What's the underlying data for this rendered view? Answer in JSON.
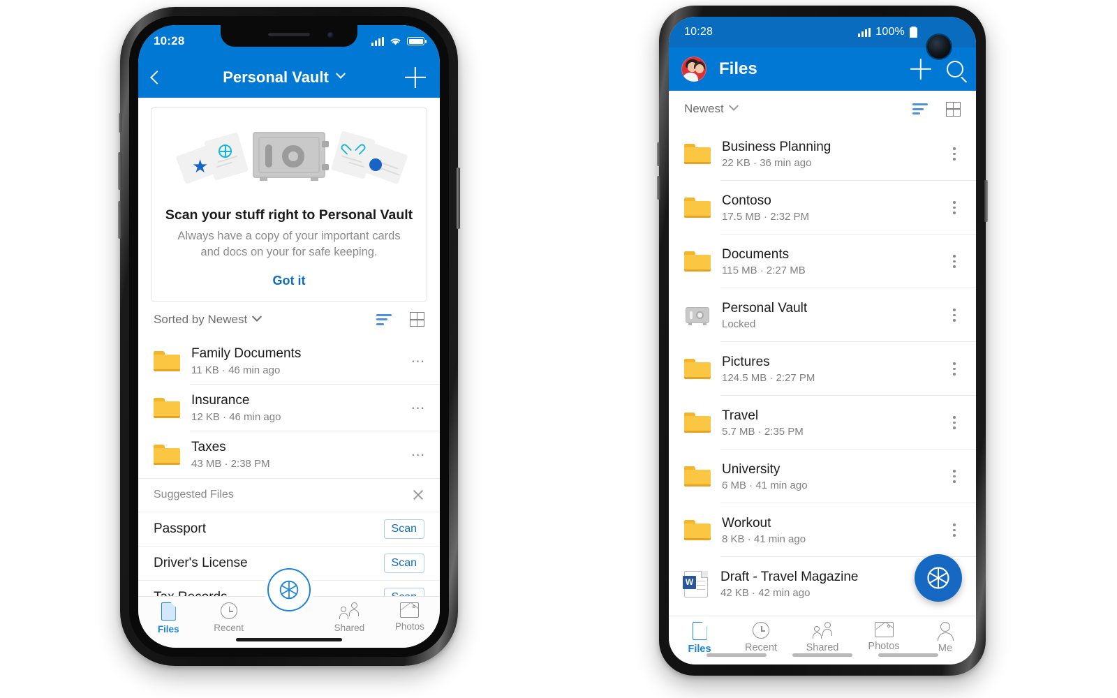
{
  "iphone": {
    "status": {
      "time": "10:28",
      "signal_icon": "cellular-signal-icon",
      "wifi_icon": "wifi-icon",
      "battery_icon": "battery-icon"
    },
    "appbar": {
      "back_icon": "back-chevron-icon",
      "title": "Personal Vault",
      "title_chevron_icon": "chevron-down-icon",
      "add_icon": "plus-icon"
    },
    "promo_card": {
      "illustration_icons": [
        "globe-icon",
        "heart-icon",
        "star-icon",
        "dot-icon",
        "safe-icon"
      ],
      "title": "Scan your stuff right to Personal Vault",
      "body": "Always have a copy of your important cards and docs on your for safe keeping.",
      "cta": "Got it"
    },
    "sort": {
      "label": "Sorted by Newest",
      "chevron_icon": "chevron-down-icon",
      "list_icon": "sort-list-icon",
      "grid_icon": "grid-view-icon"
    },
    "files": [
      {
        "icon": "folder-icon",
        "name": "Family Documents",
        "meta": "11 KB · 46 min ago",
        "menu_icon": "more-horizontal-icon"
      },
      {
        "icon": "folder-icon",
        "name": "Insurance",
        "meta": "12 KB · 46 min ago",
        "menu_icon": "more-horizontal-icon"
      },
      {
        "icon": "folder-icon",
        "name": "Taxes",
        "meta": "43 MB · 2:38 PM",
        "menu_icon": "more-horizontal-icon"
      }
    ],
    "suggested": {
      "header": "Suggested Files",
      "close_icon": "close-icon",
      "items": [
        {
          "name": "Passport",
          "action": "Scan"
        },
        {
          "name": "Driver's License",
          "action": "Scan"
        },
        {
          "name": "Tax Records",
          "action": "Scan"
        }
      ]
    },
    "scan_button_icon": "camera-aperture-icon",
    "tabs": [
      {
        "label": "Files",
        "icon": "document-icon",
        "active": true
      },
      {
        "label": "Recent",
        "icon": "clock-icon",
        "active": false
      },
      {
        "label": "Shared",
        "icon": "people-icon",
        "active": false
      },
      {
        "label": "Photos",
        "icon": "photo-icon",
        "active": false
      }
    ]
  },
  "android": {
    "status": {
      "time": "10:28",
      "signal_icon": "cellular-signal-icon",
      "battery_text": "100%",
      "battery_icon": "battery-icon"
    },
    "appbar": {
      "avatar_icon": "user-avatar",
      "title": "Files",
      "add_icon": "plus-icon",
      "search_icon": "search-icon"
    },
    "sort": {
      "label": "Newest",
      "chevron_icon": "chevron-down-icon",
      "list_icon": "sort-list-icon",
      "grid_icon": "grid-view-icon"
    },
    "files": [
      {
        "icon": "folder-icon",
        "name": "Business Planning",
        "meta": "22 KB · 36 min ago",
        "menu_icon": "more-vertical-icon"
      },
      {
        "icon": "folder-icon",
        "name": "Contoso",
        "meta": "17.5 MB · 2:32 PM",
        "menu_icon": "more-vertical-icon"
      },
      {
        "icon": "folder-icon",
        "name": "Documents",
        "meta": "115 MB · 2:27 MB",
        "menu_icon": "more-vertical-icon"
      },
      {
        "icon": "personal-vault-icon",
        "name": "Personal Vault",
        "meta": "Locked",
        "menu_icon": "more-vertical-icon"
      },
      {
        "icon": "folder-icon",
        "name": "Pictures",
        "meta": "124.5 MB · 2:27 PM",
        "menu_icon": "more-vertical-icon"
      },
      {
        "icon": "folder-icon",
        "name": "Travel",
        "meta": "5.7 MB · 2:35 PM",
        "menu_icon": "more-vertical-icon"
      },
      {
        "icon": "folder-icon",
        "name": "University",
        "meta": "6 MB · 41 min ago",
        "menu_icon": "more-vertical-icon"
      },
      {
        "icon": "folder-icon",
        "name": "Workout",
        "meta": "8 KB · 41 min ago",
        "menu_icon": "more-vertical-icon"
      },
      {
        "icon": "word-document-icon",
        "name": "Draft - Travel Magazine",
        "meta": "42 KB · 42 min ago",
        "menu_icon": "more-vertical-icon"
      }
    ],
    "fab_icon": "camera-aperture-icon",
    "tabs": [
      {
        "label": "Files",
        "icon": "document-icon",
        "active": true
      },
      {
        "label": "Recent",
        "icon": "clock-icon",
        "active": false
      },
      {
        "label": "Shared",
        "icon": "people-icon",
        "active": false
      },
      {
        "label": "Photos",
        "icon": "photo-icon",
        "active": false
      },
      {
        "label": "Me",
        "icon": "person-icon",
        "active": false
      }
    ]
  },
  "colors": {
    "brand_blue": "#0078d4",
    "status_blue_android": "#0a6cbe",
    "accent_link": "#0f6cbd",
    "tab_active": "#1a83e0",
    "folder_yellow": "#fbc642",
    "word_blue": "#2b579a",
    "teal_glyph": "#17b6d6"
  }
}
